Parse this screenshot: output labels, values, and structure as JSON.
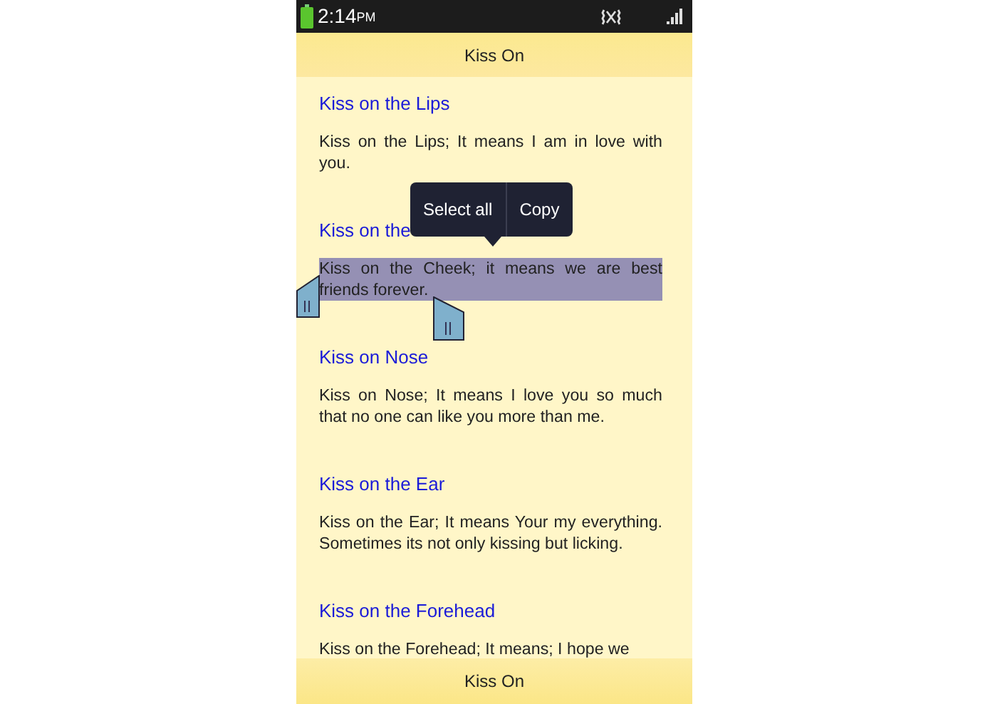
{
  "status_bar": {
    "time": "2:14",
    "ampm": "PM"
  },
  "title_bar": {
    "title": "Kiss On"
  },
  "entries": [
    {
      "heading": "Kiss on the Lips",
      "text": "Kiss on the Lips; It means I am in love with you.",
      "selected": false
    },
    {
      "heading": "Kiss on the",
      "text": "Kiss on the Cheek; it means we are best friends forever.",
      "selected": true
    },
    {
      "heading": "Kiss on Nose",
      "text": "Kiss on Nose; It means I love you so much that no one can like you more than me.",
      "selected": false
    },
    {
      "heading": "Kiss on the Ear",
      "text": "Kiss on the Ear; It means Your my everything. Sometimes its not only kissing but licking.",
      "selected": false
    },
    {
      "heading": "Kiss on the Forehead",
      "text": "Kiss on the Forehead; It means; I hope we",
      "selected": false
    }
  ],
  "context_menu": {
    "items": [
      "Select all",
      "Copy"
    ]
  },
  "bottom_bar": {
    "title": "Kiss On"
  }
}
